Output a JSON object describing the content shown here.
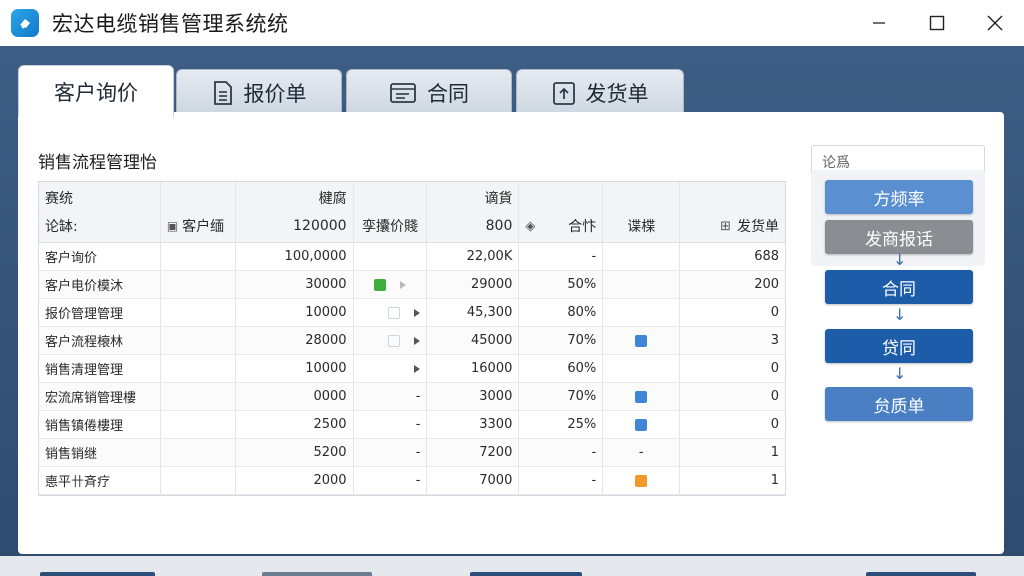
{
  "window": {
    "title": "宏达电缆销售管理系统统"
  },
  "tabs": [
    {
      "label": "客户询价",
      "icon": "none"
    },
    {
      "label": "报价单",
      "icon": "document-icon"
    },
    {
      "label": "合同",
      "icon": "contract-icon"
    },
    {
      "label": "发货单",
      "icon": "shipping-icon"
    }
  ],
  "section": {
    "title": "销售流程管理怡"
  },
  "table": {
    "header_top": [
      "赛统",
      "",
      "楗腐",
      "",
      "谪貨",
      "",
      "",
      ""
    ],
    "header_bottom": [
      "论缽:",
      "客户缅",
      "120000",
      "孪攮价賤",
      "800",
      "合忭",
      "谍楪",
      "发货单"
    ],
    "rows": [
      [
        "客户询价",
        "",
        "100,0000",
        "",
        "22,00K",
        "-",
        "",
        "688"
      ],
      [
        "客户电价模沐",
        "",
        "30000",
        "green",
        "29000",
        "50%",
        "",
        "200"
      ],
      [
        "报价管理管理",
        "",
        "10000",
        "tri",
        "45,300",
        "80%",
        "",
        "0"
      ],
      [
        "客户流程榱林",
        "",
        "28000",
        "tri",
        "45000",
        "70%",
        "blue",
        "3"
      ],
      [
        "销售清理管理",
        "",
        "10000",
        "tri",
        "16000",
        "60%",
        "",
        "0"
      ],
      [
        "宏流席销管理樓",
        "",
        "0000",
        "-",
        "3000",
        "70%",
        "blue",
        "0"
      ],
      [
        "销售镇倦樓理",
        "",
        "2500",
        "-",
        "3300",
        "25%",
        "blue",
        "0"
      ],
      [
        "销售销继",
        "",
        "5200",
        "-",
        "7200",
        "-",
        "-",
        "1"
      ],
      [
        "㥁平卄斉疗",
        "",
        "2000",
        "-",
        "7000",
        "-",
        "orange",
        "1"
      ]
    ]
  },
  "flow": {
    "search_placeholder": "论爲",
    "steps": [
      {
        "label": "方频率",
        "color": "#5a8fd1"
      },
      {
        "label": "发商报话",
        "color": "#8a8d91"
      },
      {
        "label": "合同",
        "color": "#1d5ca8"
      },
      {
        "label": "贷同",
        "color": "#1d5ca8"
      },
      {
        "label": "贠质单",
        "color": "#4a7fc4"
      }
    ]
  },
  "colors": {
    "green": "#3fae3f",
    "blue": "#3f86d6",
    "orange": "#f19a2a"
  }
}
